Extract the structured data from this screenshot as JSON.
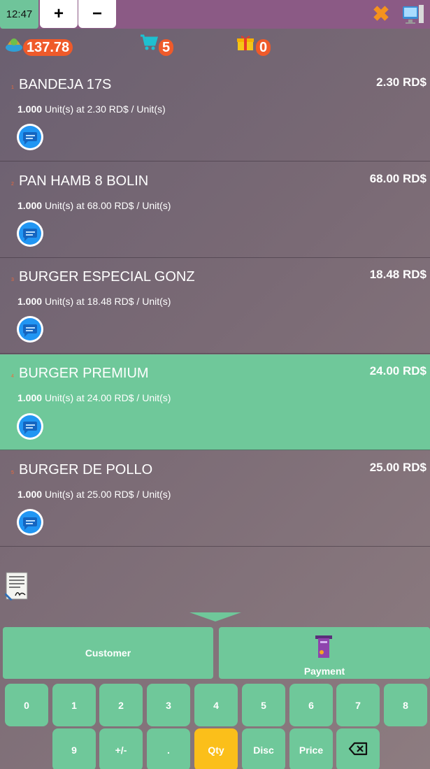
{
  "topbar": {
    "time": "12:47",
    "add_tab_label": "+",
    "remove_tab_label": "−"
  },
  "stats": {
    "total": "137.78",
    "cart_count": "5",
    "gift_count": "0"
  },
  "order_lines": [
    {
      "index": "1",
      "name": "BANDEJA 17S",
      "price": "2.30 RD$",
      "qty": "1.000",
      "unit_text": "Unit(s) at 2.30 RD$ / Unit(s)",
      "selected": false
    },
    {
      "index": "2",
      "name": "PAN HAMB 8 BOLIN",
      "price": "68.00 RD$",
      "qty": "1.000",
      "unit_text": "Unit(s) at 68.00 RD$ / Unit(s)",
      "selected": false
    },
    {
      "index": "3",
      "name": "BURGER ESPECIAL GONZ",
      "price": "18.48 RD$",
      "qty": "1.000",
      "unit_text": "Unit(s) at 18.48 RD$ / Unit(s)",
      "selected": false
    },
    {
      "index": "4",
      "name": "BURGER PREMIUM",
      "price": "24.00 RD$",
      "qty": "1.000",
      "unit_text": "Unit(s) at 24.00 RD$ / Unit(s)",
      "selected": true
    },
    {
      "index": "5",
      "name": "BURGER DE POLLO",
      "price": "25.00 RD$",
      "qty": "1.000",
      "unit_text": "Unit(s) at 25.00 RD$ / Unit(s)",
      "selected": false
    }
  ],
  "actions": {
    "customer_label": "Customer",
    "payment_label": "Payment"
  },
  "keypad": {
    "row1": [
      "0",
      "1",
      "2",
      "3",
      "4",
      "5",
      "6",
      "7",
      "8"
    ],
    "row2": [
      "9",
      "+/-",
      ".",
      "Qty",
      "Disc",
      "Price"
    ],
    "active_key": "Qty"
  },
  "icons": {
    "money": "money-bag-icon",
    "cart": "cart-icon",
    "gift": "gift-icon",
    "close": "close-icon",
    "monitor": "monitor-icon",
    "note": "note-icon",
    "signature": "signature-icon",
    "payment": "card-terminal-icon",
    "backspace": "backspace-icon"
  },
  "colors": {
    "accent": "#6fc89a",
    "topbar": "#8b5a85",
    "badge": "#ef5a2a",
    "active_key": "#fbbf1a",
    "close": "#f5921e"
  }
}
